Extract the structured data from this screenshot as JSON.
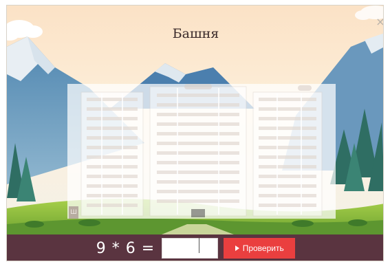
{
  "game": {
    "title": "Башня",
    "equation": "9 * 6 =",
    "answer_value": "",
    "check_label": "Проверить",
    "hint_label": "Ш",
    "close_symbol": "×"
  },
  "colors": {
    "bottom_bar": "#5a3440",
    "check_button": "#ea3f3f",
    "sky_top": "#fbe6cc",
    "mountain": "#5b8fb5",
    "grass": "#8cbf3f",
    "pine": "#2f6e63"
  },
  "icons": {
    "close": "close-icon",
    "play": "play-icon",
    "cloud": "cloud-icon"
  }
}
